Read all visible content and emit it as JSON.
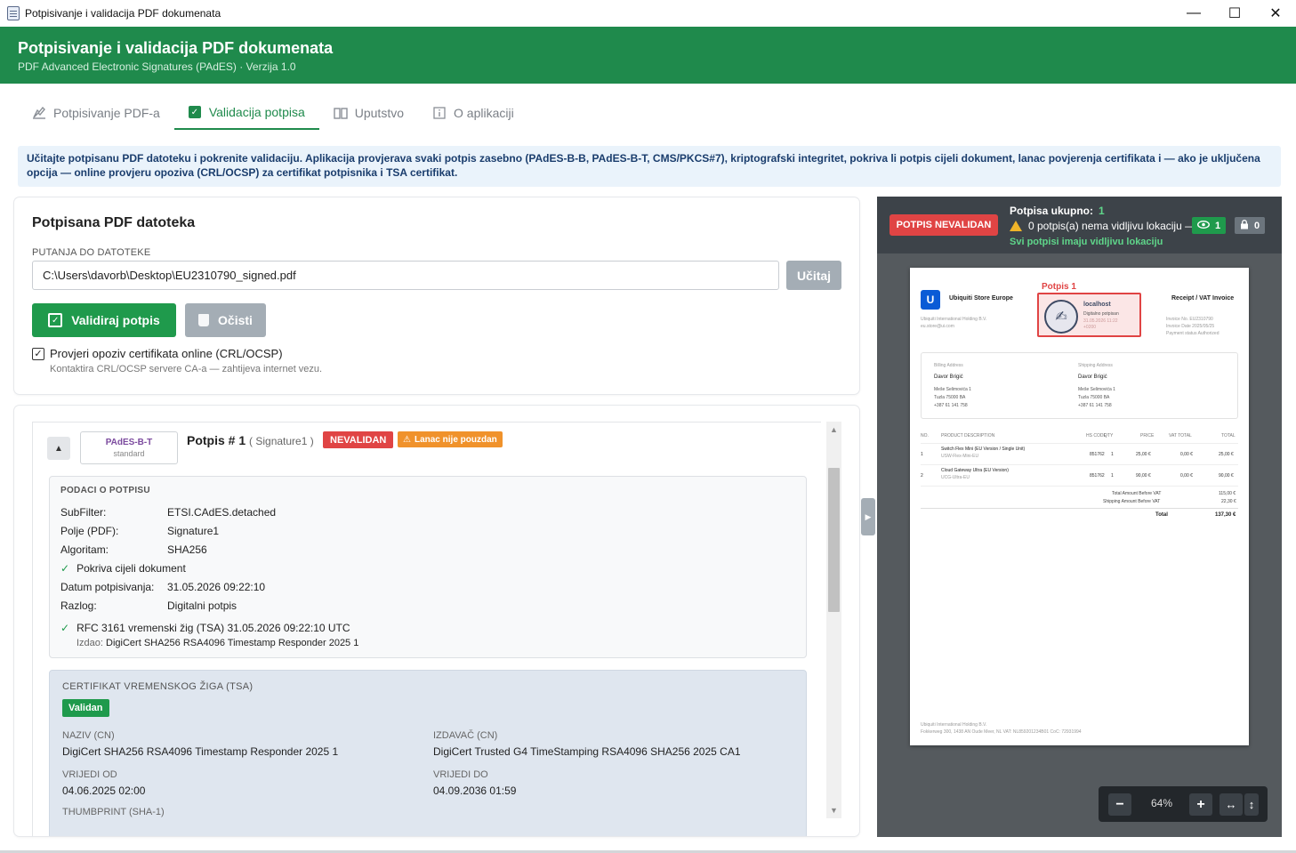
{
  "window": {
    "title": "Potpisivanje i validacija PDF dokumenata",
    "minimize": "—",
    "maximize": "☐",
    "close": "✕"
  },
  "header": {
    "title": "Potpisivanje i validacija PDF dokumenata",
    "subtitle": "PDF Advanced Electronic Signatures (PAdES)  ·  Verzija 1.0"
  },
  "tabs": [
    {
      "label": "Potpisivanje PDF-a",
      "icon": "pen-sign-icon"
    },
    {
      "label": "Validacija potpisa",
      "icon": "check-box-icon"
    },
    {
      "label": "Uputstvo",
      "icon": "book-icon"
    },
    {
      "label": "O aplikaciji",
      "icon": "info-icon"
    }
  ],
  "info_text": "Učitajte potpisanu PDF datoteku i pokrenite validaciju. Aplikacija provjerava svaki potpis zasebno (PAdES-B-B, PAdES-B-T, CMS/PKCS#7), kriptografski integritet, pokriva li potpis cijeli dokument, lanac povjerenja certifikata i — ako je uključena opcija — online provjeru opoziva (CRL/OCSP) za certifikat potpisnika i TSA certifikat.",
  "file_card": {
    "title": "Potpisana PDF datoteka",
    "path_label": "PUTANJA DO DATOTEKE",
    "path_value": "C:\\Users\\davorb\\Desktop\\EU2310790_signed.pdf",
    "load_button": "Učitaj",
    "validate_button": "Validiraj potpis",
    "clear_button": "Očisti",
    "crl_checkbox_label": "Provjeri opoziv certifikata online (CRL/OCSP)",
    "crl_checked": true,
    "crl_hint": "Kontaktira CRL/OCSP servere CA-a — zahtijeva internet vezu."
  },
  "signature": {
    "type": "PAdES-B-T",
    "type_sub": "standard",
    "title": "Potpis # 1",
    "field_name": "( Signature1 )",
    "status_badge": "NEVALIDAN",
    "chain_badge": "Lanac nije pouzdan",
    "details_label": "PODACI O POTPISU",
    "details": [
      {
        "k": "SubFilter:",
        "v": "ETSI.CAdES.detached"
      },
      {
        "k": "Polje (PDF):",
        "v": "Signature1"
      },
      {
        "k": "Algoritam:",
        "v": "SHA256"
      }
    ],
    "covers_whole": "Pokriva cijeli dokument",
    "details2": [
      {
        "k": "Datum potpisivanja:",
        "v": "31.05.2026 09:22:10"
      },
      {
        "k": "Razlog:",
        "v": "Digitalni potpis"
      }
    ],
    "timestamp_line": "RFC 3161 vremenski žig (TSA)  31.05.2026 09:22:10 UTC",
    "issuer_label": "Izdao:",
    "issuer_value": "DigiCert SHA256 RSA4096 Timestamp Responder 2025 1",
    "tsa_cert": {
      "label": "CERTIFIKAT VREMENSKOG ŽIGA (TSA)",
      "status": "Validan",
      "name_label": "NAZIV (CN)",
      "name_value": "DigiCert SHA256 RSA4096 Timestamp Responder 2025 1",
      "issuer_label": "IZDAVAČ (CN)",
      "issuer_value": "DigiCert Trusted G4 TimeStamping RSA4096 SHA256 2025 CA1",
      "valid_from_label": "VRIJEDI OD",
      "valid_from": "04.06.2025 02:00",
      "valid_to_label": "VRIJEDI DO",
      "valid_to": "04.09.2036 01:59",
      "thumbprint_label": "THUMBPRINT (SHA-1)"
    }
  },
  "viewer": {
    "status_badge": "POTPIS NEVALIDAN",
    "total_label": "Potpisa ukupno:",
    "total_value": "1",
    "warn_text": "0 potpis(a) nema vidljivu lokaciju —",
    "ok_text": "Svi potpisi imaju vidljivu lokaciju",
    "visible_count": "1",
    "hidden_count": "0",
    "zoom": "64%",
    "zoom_minus": "−",
    "zoom_plus": "+",
    "fit_width": "↔",
    "fit_height": "↕",
    "page": {
      "company": "Ubiquiti Store Europe",
      "company_sub1": "Ubiquiti International Holding B.V.",
      "company_sub2": "eu.store@ui.com",
      "invoice_title": "Receipt / VAT Invoice",
      "invoice_meta": [
        "Invoice No.   EU2310790",
        "Invoice Date   2025/05/25",
        "Payment status   Authorized"
      ],
      "sig_label": "Potpis 1",
      "sig_name": "localhost",
      "sig_line1": "Digitalno potpisan",
      "sig_line2": "31.05.2026 11:22",
      "sig_line3": "+0200",
      "billing_label": "Billing Address",
      "shipping_label": "Shipping Address",
      "billing_name": "Davor Brigić",
      "shipping_name": "Davor Brigić",
      "billing_lines": [
        "Meše Selimovića 1",
        "Tuzla 75000 BA",
        "+387 61 141 758"
      ],
      "shipping_lines": [
        "Meše Selimovića 1",
        "Tuzla 75000 BA",
        "+387 61 141 758"
      ],
      "table_head": [
        "NO.",
        "PRODUCT DESCRIPTION",
        "HS CODE",
        "QTY",
        "PRICE",
        "VAT TOTAL",
        "TOTAL"
      ],
      "rows": [
        {
          "no": "1",
          "desc": "Switch Flex Mini (EU Version / Single Unit)",
          "sku": "USW-Flex-Mini-EU",
          "hs": "851762",
          "qty": "1",
          "price": "25,00 €",
          "vat": "0,00 €",
          "total": "25,00 €"
        },
        {
          "no": "2",
          "desc": "Cloud Gateway Ultra (EU Version)",
          "sku": "UCG-Ultra-EU",
          "hs": "851762",
          "qty": "1",
          "price": "90,00 €",
          "vat": "0,00 €",
          "total": "90,00 €"
        }
      ],
      "sum1_label": "Total Amount Before VAT",
      "sum1_value": "115,00 €",
      "sum2_label": "Shipping Amount Before VAT",
      "sum2_value": "22,30 €",
      "total_label": "Total",
      "total_value": "137,30 €",
      "footer1": "Ubiquiti International Holding B.V.",
      "footer2": "Fokkerweg 300, 1438 AN Oude Meer, NL VAT: NL859201234B01 CoC: 72931994"
    }
  }
}
